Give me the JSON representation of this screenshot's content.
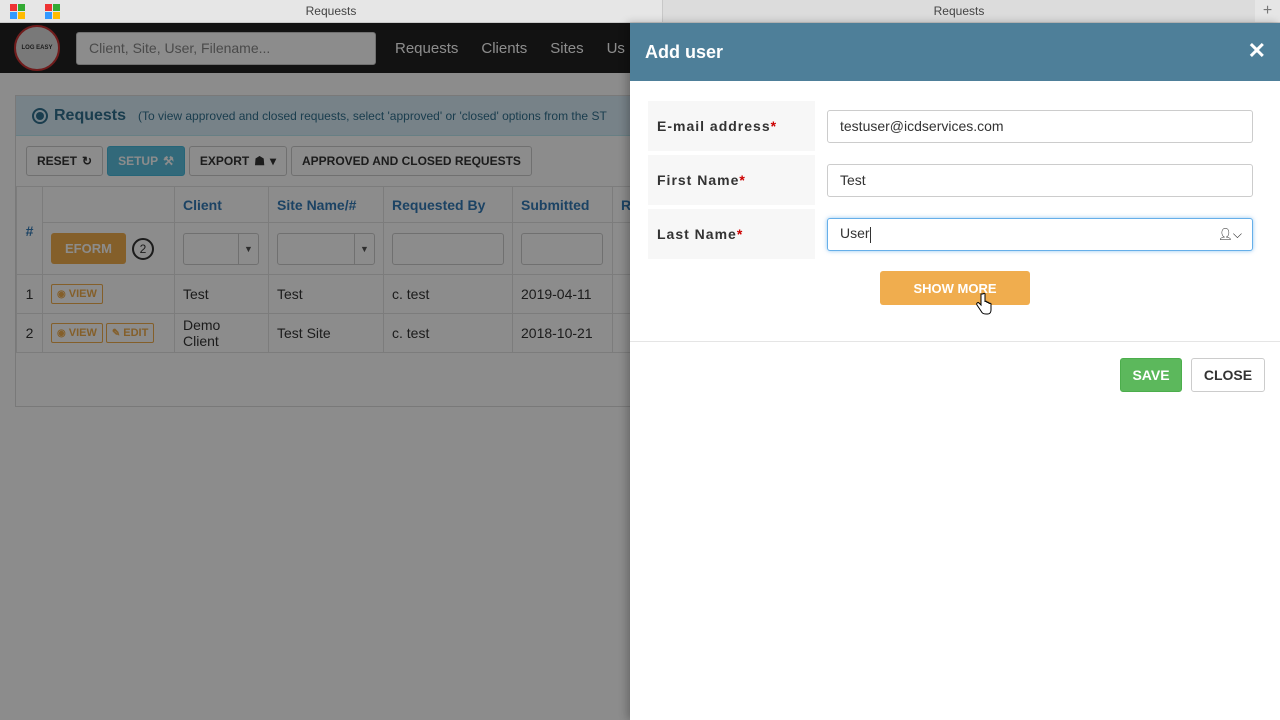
{
  "browser": {
    "tabs": [
      {
        "label": "Requests"
      },
      {
        "label": "Requests"
      }
    ],
    "new_tab_icon": "plus-icon"
  },
  "nav": {
    "logo_text": "LOG EASY",
    "search_placeholder": "Client, Site, User, Filename...",
    "links": [
      "Requests",
      "Clients",
      "Sites",
      "Us"
    ]
  },
  "page": {
    "panel_title": "Requests",
    "panel_note": "(To view approved and closed requests, select 'approved' or 'closed' options from the ST",
    "toolbar": {
      "reset": "RESET",
      "setup": "SETUP",
      "export": "EXPORT",
      "approved_closed": "APPROVED AND CLOSED REQUESTS"
    },
    "table": {
      "headers": [
        "#",
        "Client",
        "Site Name/#",
        "Requested By",
        "Submitted",
        "R"
      ],
      "eform_label": "EFORM",
      "eform_count": "2",
      "rows": [
        {
          "num": "1",
          "actions": [
            "VIEW"
          ],
          "client": "Test",
          "site": "Test",
          "requested_by": "c. test",
          "submitted": "2019-04-11"
        },
        {
          "num": "2",
          "actions": [
            "VIEW",
            "EDIT"
          ],
          "client": "Demo Client",
          "site": "Test Site",
          "requested_by": "c. test",
          "submitted": "2018-10-21"
        }
      ]
    }
  },
  "modal": {
    "title": "Add user",
    "fields": [
      {
        "label": "E-mail address",
        "required": "*",
        "value": "testuser@icdservices.com"
      },
      {
        "label": "First Name",
        "required": "*",
        "value": "Test"
      },
      {
        "label": "Last Name",
        "required": "*",
        "value": "User"
      }
    ],
    "show_more": "SHOW MORE",
    "save": "SAVE",
    "close": "CLOSE"
  }
}
